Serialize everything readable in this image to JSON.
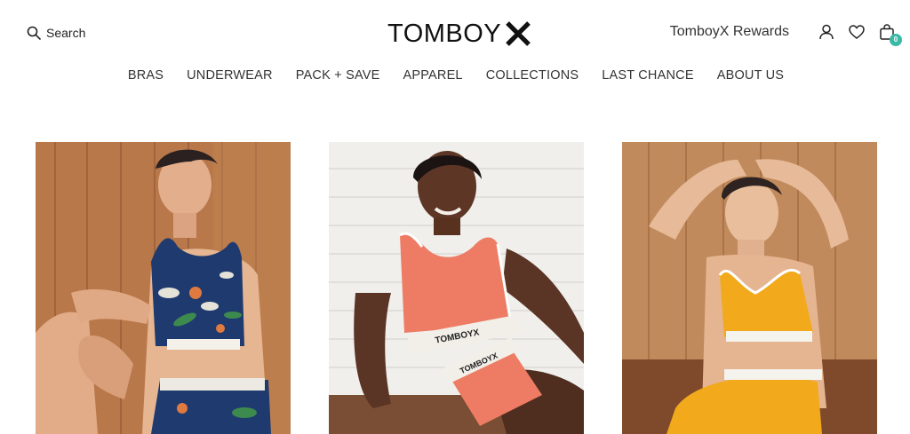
{
  "header": {
    "search_label": "Search",
    "logo_text": "TOMBOY",
    "rewards_label": "TomboyX Rewards",
    "cart_count": "0"
  },
  "nav": {
    "items": [
      {
        "label": "BRAS"
      },
      {
        "label": "UNDERWEAR"
      },
      {
        "label": "PACK + SAVE"
      },
      {
        "label": "APPAREL"
      },
      {
        "label": "COLLECTIONS"
      },
      {
        "label": "LAST CHANCE"
      },
      {
        "label": "ABOUT US"
      }
    ]
  },
  "icons": {
    "search": "search-icon",
    "account": "user-icon",
    "wishlist": "heart-icon",
    "cart": "shopping-bag-icon"
  },
  "colors": {
    "accent_badge": "#3cb9a6",
    "text": "#222222",
    "background": "#ffffff"
  },
  "products": [
    {
      "band_text": ""
    },
    {
      "band_text": "TOMBOYX"
    },
    {
      "band_text": ""
    }
  ]
}
